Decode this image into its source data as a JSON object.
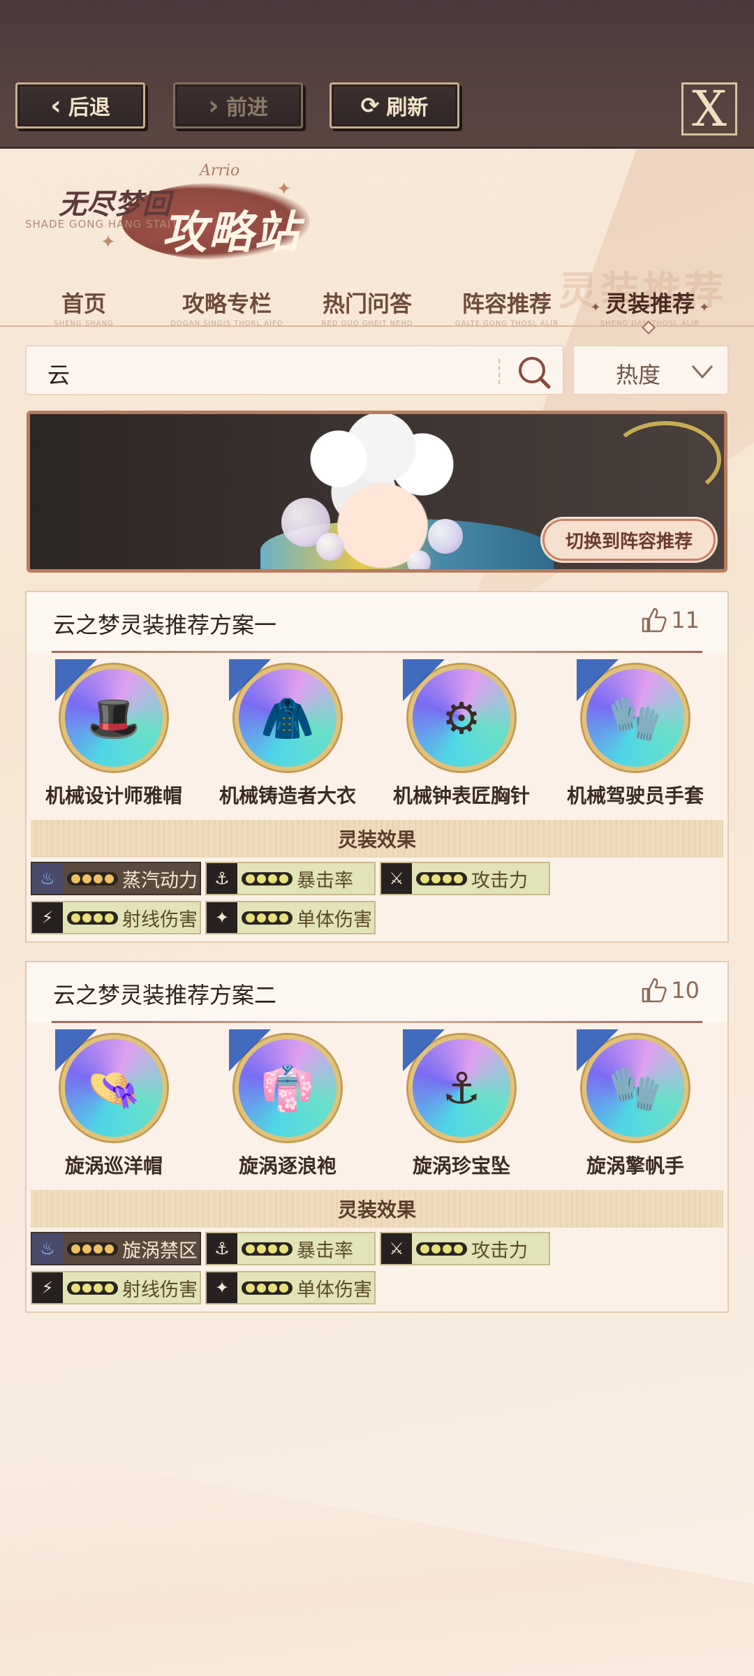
{
  "browser": {
    "back_label": "后退",
    "forward_label": "前进",
    "refresh_label": "刷新",
    "close_glyph": "X"
  },
  "logo": {
    "title_top": "无尽梦回",
    "title_main": "攻略站",
    "subtitle": "SHADE GONG HANG STAIT",
    "signature": "Arrio"
  },
  "watermark": "灵装推荐",
  "tabs": [
    {
      "label": "首页",
      "en": "SHENG SHANG",
      "active": false
    },
    {
      "label": "攻略专栏",
      "en": "DOGAN SINGIS THORL AIFO",
      "active": false
    },
    {
      "label": "热门问答",
      "en": "RED GUO GHEIT NEHD",
      "active": false
    },
    {
      "label": "阵容推荐",
      "en": "GALTE GONG THOSL ALIR",
      "active": false
    },
    {
      "label": "灵装推荐",
      "en": "SHENG DAN THOSL ALIR",
      "active": true
    }
  ],
  "search": {
    "value": "云",
    "icon": "search-icon"
  },
  "sort": {
    "label": "热度",
    "icon": "chevron-down-icon"
  },
  "banner": {
    "button_label": "切换到阵容推荐"
  },
  "cards": [
    {
      "title": "云之梦灵装推荐方案一",
      "likes": "11",
      "items": [
        {
          "name": "机械设计师雅帽",
          "glyph": "🎩"
        },
        {
          "name": "机械铸造者大衣",
          "glyph": "🧥"
        },
        {
          "name": "机械钟表匠胸针",
          "glyph": "⚙"
        },
        {
          "name": "机械驾驶员手套",
          "glyph": "🧤"
        }
      ],
      "effect_title": "灵装效果",
      "effects": [
        {
          "label": "蒸汽动力",
          "icon": "flame-icon",
          "glyph": "♨",
          "dark": true
        },
        {
          "label": "暴击率",
          "icon": "anchor-icon",
          "glyph": "⚓",
          "dark": false
        },
        {
          "label": "攻击力",
          "icon": "sword-icon",
          "glyph": "⚔",
          "dark": false
        },
        {
          "label": "射线伤害",
          "icon": "beam-icon",
          "glyph": "⚡",
          "dark": false
        },
        {
          "label": "单体伤害",
          "icon": "target-icon",
          "glyph": "✦",
          "dark": false
        }
      ]
    },
    {
      "title": "云之梦灵装推荐方案二",
      "likes": "10",
      "items": [
        {
          "name": "旋涡巡洋帽",
          "glyph": "👒"
        },
        {
          "name": "旋涡逐浪袍",
          "glyph": "👘"
        },
        {
          "name": "旋涡珍宝坠",
          "glyph": "⚓"
        },
        {
          "name": "旋涡擎帆手",
          "glyph": "🧤"
        }
      ],
      "effect_title": "灵装效果",
      "effects": [
        {
          "label": "旋涡禁区",
          "icon": "flame-icon",
          "glyph": "♨",
          "dark": true
        },
        {
          "label": "暴击率",
          "icon": "anchor-icon",
          "glyph": "⚓",
          "dark": false
        },
        {
          "label": "攻击力",
          "icon": "sword-icon",
          "glyph": "⚔",
          "dark": false
        },
        {
          "label": "射线伤害",
          "icon": "beam-icon",
          "glyph": "⚡",
          "dark": false
        },
        {
          "label": "单体伤害",
          "icon": "target-icon",
          "glyph": "✦",
          "dark": false
        }
      ]
    }
  ]
}
